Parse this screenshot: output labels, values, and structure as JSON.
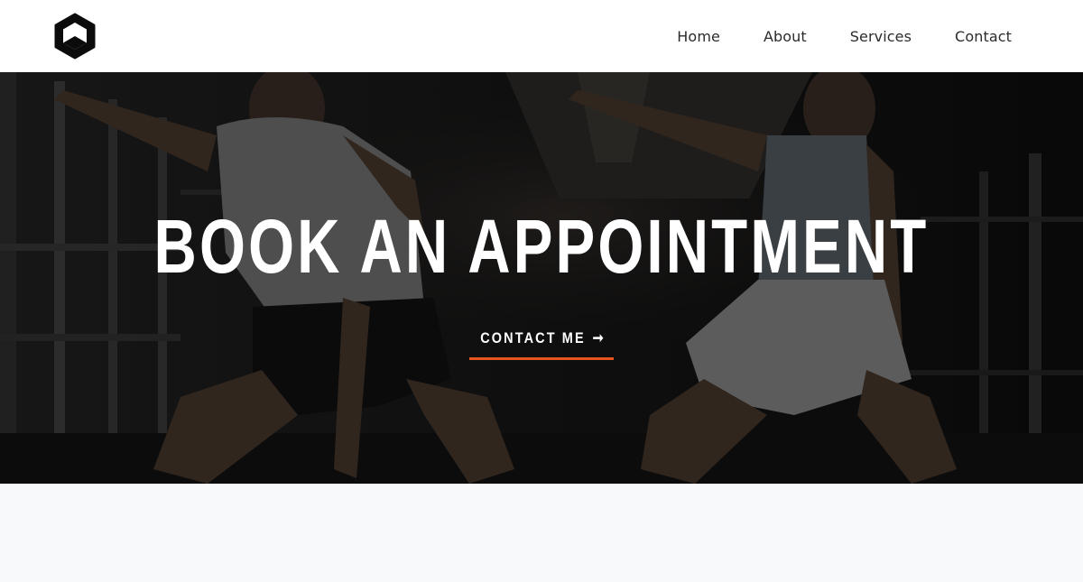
{
  "brand": {
    "logo_icon": "hexagon-logo-icon"
  },
  "nav": {
    "items": [
      {
        "label": "Home"
      },
      {
        "label": "About"
      },
      {
        "label": "Services"
      },
      {
        "label": "Contact"
      }
    ]
  },
  "hero": {
    "background_image": "gym-workout-photo",
    "title": "BOOK AN APPOINTMENT",
    "cta_label": "CONTACT ME",
    "cta_icon": "arrow-right-icon",
    "cta_arrow_glyph": "➞"
  },
  "colors": {
    "header_bg": "#ffffff",
    "nav_text": "#2b2b2b",
    "hero_text": "#ffffff",
    "accent": "#e8541e",
    "page_bg": "#f8f9fb"
  }
}
